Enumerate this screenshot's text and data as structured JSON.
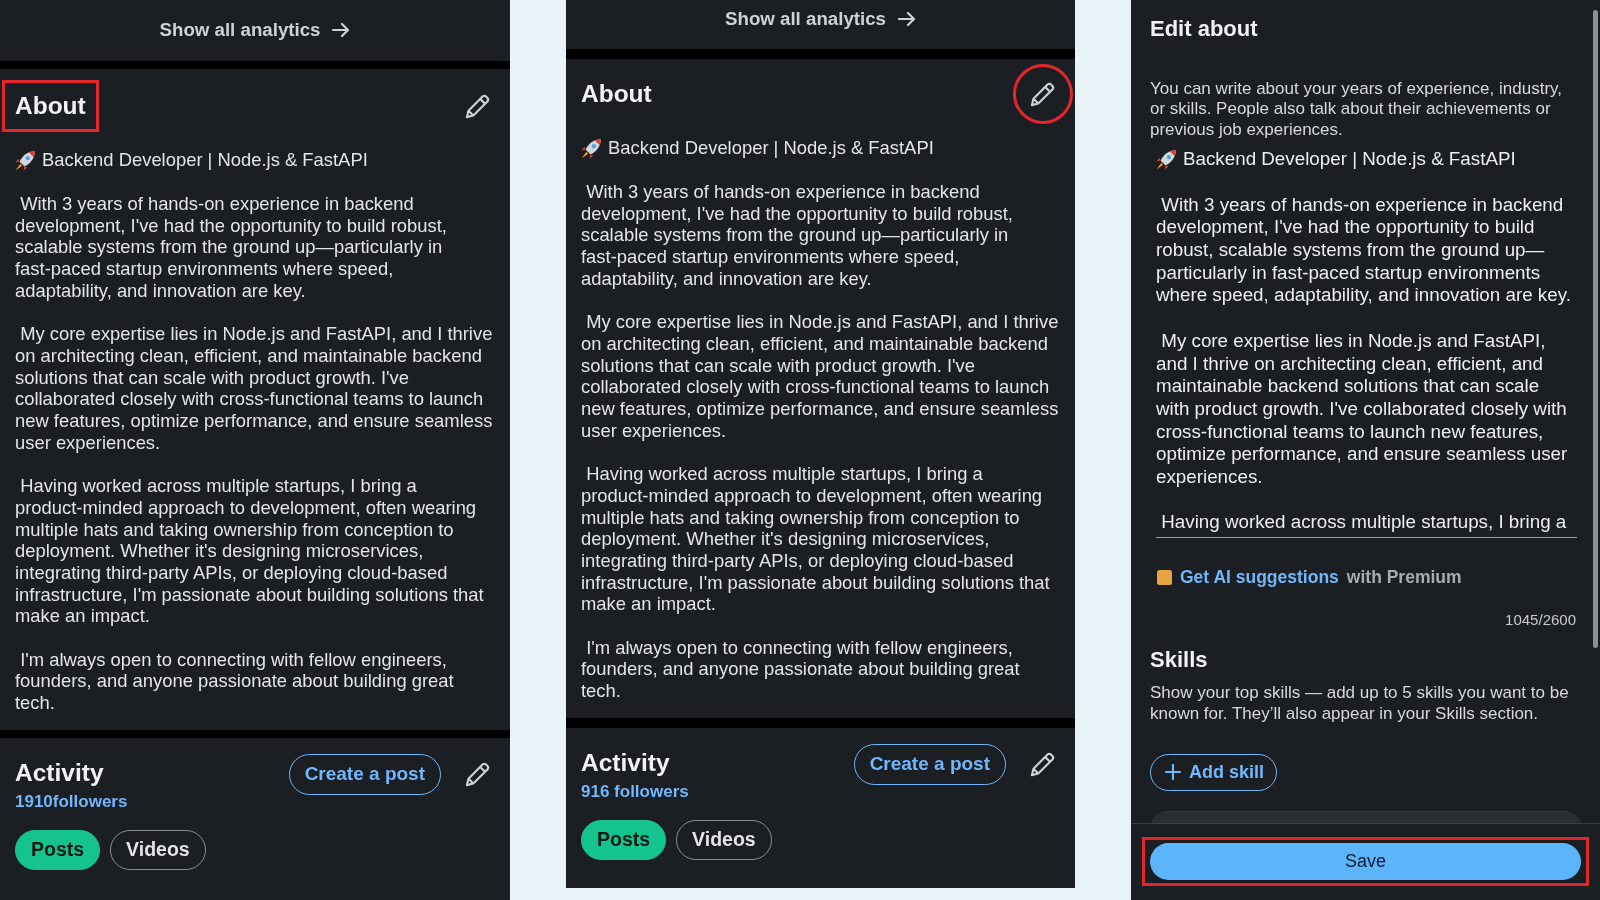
{
  "panels": [
    {
      "kind": "profile",
      "analytics_link": "Show all analytics",
      "about": {
        "title": "About",
        "title_highlighted": true,
        "edit_highlighted": false,
        "headline": "Backend Developer | Node.js & FastAPI",
        "paragraphs": [
          "With 3 years of hands-on experience in backend development, I've had the opportunity to build robust, scalable systems from the ground up—particularly in fast-paced startup environments where speed, adaptability, and innovation are key.",
          "My core expertise lies in Node.js and FastAPI, and I thrive on architecting clean, efficient, and maintainable backend solutions that can scale with product growth. I've collaborated closely with cross-functional teams to launch new features, optimize performance, and ensure seamless user experiences.",
          "Having worked across multiple startups, I bring a product-minded approach to development, often wearing multiple hats and taking ownership from conception to deployment. Whether it's designing microservices, integrating third-party APIs, or deploying cloud-based infrastructure, I'm passionate about building solutions that make an impact.",
          "I'm always open to connecting with fellow engineers, founders, and anyone passionate about building great tech."
        ]
      },
      "activity": {
        "title": "Activity",
        "followers": "1910followers",
        "create_button": "Create a post",
        "filters": [
          {
            "label": "Posts",
            "selected": true
          },
          {
            "label": "Videos",
            "selected": false
          }
        ]
      }
    },
    {
      "kind": "profile",
      "analytics_link": "Show all analytics",
      "about": {
        "title": "About",
        "title_highlighted": false,
        "edit_highlighted": true,
        "headline": "Backend Developer | Node.js & FastAPI",
        "paragraphs": [
          "With 3 years of hands-on experience in backend development, I've had the opportunity to build robust, scalable systems from the ground up—particularly in fast-paced startup environments where speed, adaptability, and innovation are key.",
          "My core expertise lies in Node.js and FastAPI, and I thrive on architecting clean, efficient, and maintainable backend solutions that can scale with product growth. I've collaborated closely with cross-functional teams to launch new features, optimize performance, and ensure seamless user experiences.",
          "Having worked across multiple startups, I bring a product-minded approach to development, often wearing multiple hats and taking ownership from conception to deployment. Whether it's designing microservices, integrating third-party APIs, or deploying cloud-based infrastructure, I'm passionate about building solutions that make an impact.",
          "I'm always open to connecting with fellow engineers, founders, and anyone passionate about building great tech."
        ]
      },
      "activity": {
        "title": "Activity",
        "followers": "916 followers",
        "create_button": "Create a post",
        "filters": [
          {
            "label": "Posts",
            "selected": true
          },
          {
            "label": "Videos",
            "selected": false
          }
        ]
      }
    },
    {
      "kind": "editor",
      "title": "Edit about",
      "hint": "You can write about your years of experience, industry, or skills. People also talk about their achievements or previous job experiences.",
      "field": {
        "headline": "Backend Developer | Node.js & FastAPI",
        "paragraphs": [
          "With 3 years of hands-on experience in backend development, I've had the opportunity to build robust, scalable systems from the ground up—particularly in fast-paced startup environments where speed, adaptability, and innovation are key.",
          "My core expertise lies in Node.js and FastAPI, and I thrive on architecting clean, efficient, and maintainable backend solutions that can scale with product growth. I've collaborated closely with cross-functional teams to launch new features, optimize performance, and ensure seamless user experiences.",
          "Having worked across multiple startups, I bring a"
        ]
      },
      "ai_link": "Get AI suggestions",
      "ai_note": "with Premium",
      "counter": "1045/2600",
      "skills": {
        "title": "Skills",
        "description": "Show your top skills — add up to 5 skills you want to be known for. They’ll also appear in your Skills section.",
        "add_button": "Add skill"
      },
      "save_button": "Save",
      "save_highlighted": true
    }
  ]
}
